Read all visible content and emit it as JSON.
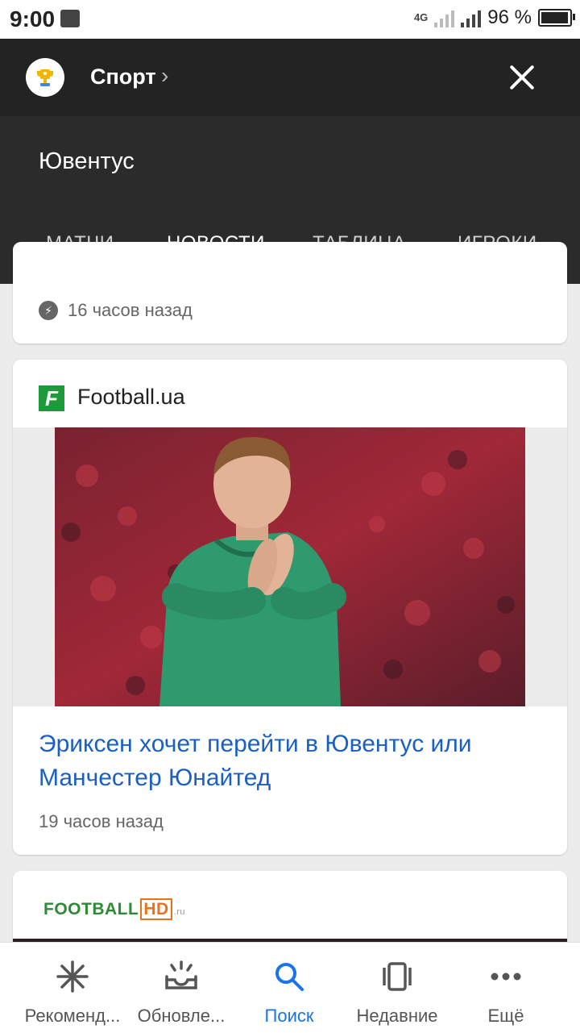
{
  "status_bar": {
    "time": "9:00",
    "network": "4G",
    "battery": "96 %",
    "battery_level": 0.96
  },
  "top_bar": {
    "title": "Спорт",
    "chevron": "›",
    "trophy_icon": "trophy-icon",
    "close_icon": "close-icon"
  },
  "team_header": {
    "team_name": "Ювентус",
    "tabs": [
      {
        "label": "МАТЧИ",
        "active": false
      },
      {
        "label": "НОВОСТИ",
        "active": true
      },
      {
        "label": "ТАБЛИЦА",
        "active": false
      },
      {
        "label": "ИГРОКИ",
        "active": false
      }
    ]
  },
  "feed": {
    "partial_card": {
      "time": "16 часов назад",
      "icon": "bolt-icon"
    },
    "article": {
      "source": "Football.ua",
      "source_logo_letter": "F",
      "headline": "Эриксен хочет перейти в Ювентус или Манчестер Юнайтед",
      "time": "19 часов назад"
    },
    "next_card": {
      "logo_main": "FOOTBALL",
      "logo_hd": "HD",
      "logo_suffix": ".ru"
    }
  },
  "bottom_nav": [
    {
      "label": "Рекоменд...",
      "icon": "asterisk-icon",
      "active": false
    },
    {
      "label": "Обновле...",
      "icon": "updates-icon",
      "active": false
    },
    {
      "label": "Поиск",
      "icon": "search-icon",
      "active": true
    },
    {
      "label": "Недавние",
      "icon": "recent-icon",
      "active": false
    },
    {
      "label": "Ещё",
      "icon": "more-icon",
      "active": false
    }
  ],
  "colors": {
    "accent": "#1a73e8",
    "headline": "#1a5fc2",
    "header_bg": "#2b2b2b",
    "topbar_bg": "#232323"
  }
}
